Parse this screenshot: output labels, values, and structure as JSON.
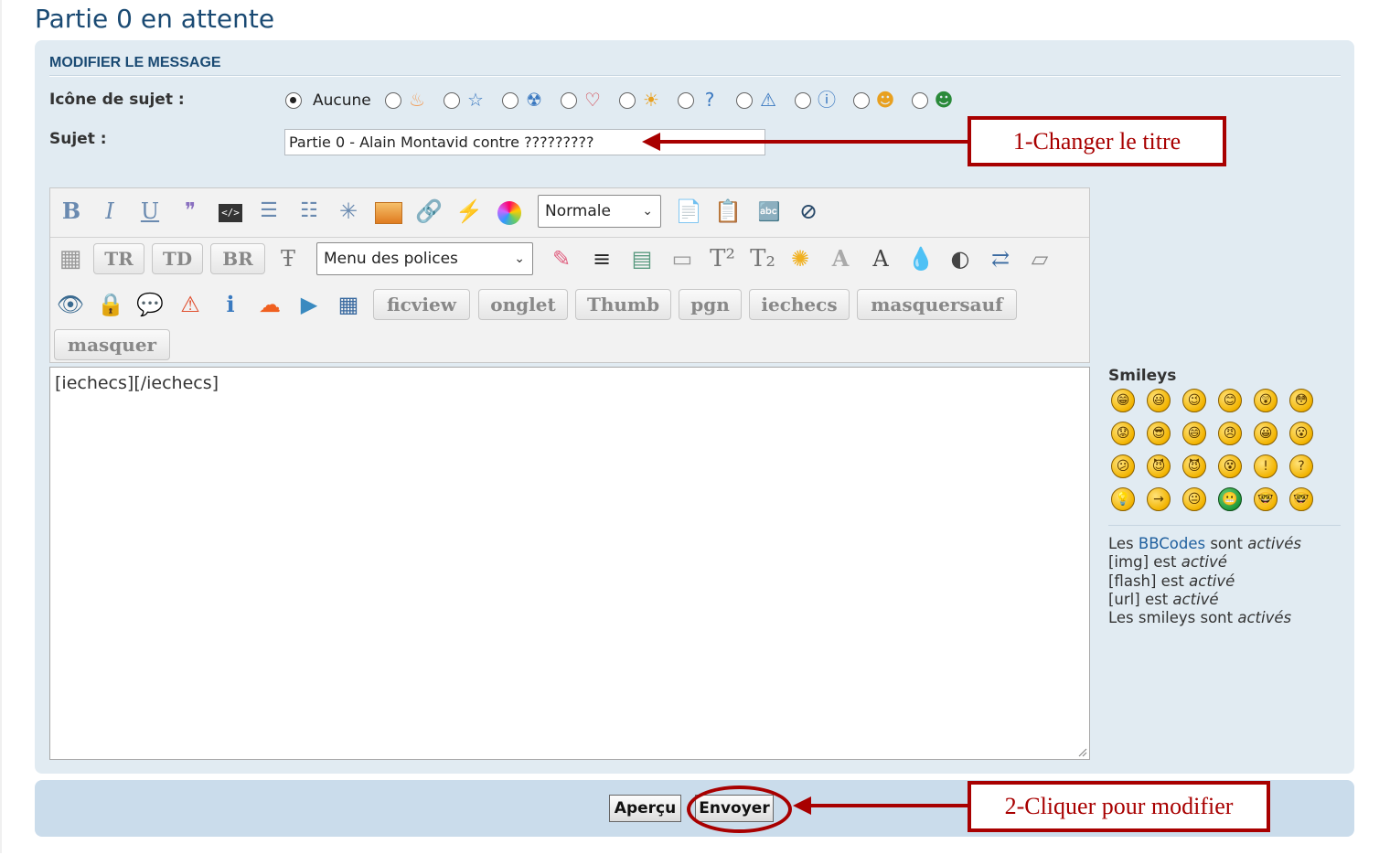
{
  "page": {
    "title": "Partie 0 en attente"
  },
  "form": {
    "section_title": "MODIFIER LE MESSAGE",
    "topic_icon_label": "Icône de sujet :",
    "topic_icon_none": "Aucune",
    "topic_icons": [
      "flame-icon",
      "star-icon",
      "radioactive-icon",
      "heart-icon",
      "sun-icon",
      "question-icon",
      "warning-icon",
      "info-icon",
      "wink-icon",
      "grin-icon"
    ],
    "subject_label": "Sujet :",
    "subject_value": "Partie 0  - Alain Montavid contre ?????????"
  },
  "toolbar": {
    "row1_icons": [
      "bold-icon",
      "italic-icon",
      "underline-icon",
      "quote-icon",
      "code-icon",
      "bullet-list-icon",
      "numbered-list-icon",
      "special-char-icon",
      "image-icon",
      "link-icon",
      "flash-icon",
      "color-icon"
    ],
    "size_select": "Normale",
    "row1_after": [
      "copy-icon",
      "paste-icon",
      "spellcheck-icon",
      "hide-icon"
    ],
    "table_buttons": [
      "TR",
      "TD",
      "BR"
    ],
    "font_select": "Menu des polices",
    "row2_icons": [
      "highlight-icon",
      "align-center-icon",
      "table-layout-icon",
      "frame-icon",
      "superscript-icon",
      "subscript-icon",
      "sun-glow-icon",
      "shadow-text-icon",
      "outline-text-icon",
      "drop-icon",
      "contrast-icon",
      "swap-icon",
      "page-icon"
    ],
    "row3_icons": [
      "spoiler-eye-icon",
      "lock-icon",
      "speech-icon",
      "alert-icon",
      "info-bar-icon",
      "soundcloud-icon",
      "video-icon",
      "grid-icon"
    ],
    "custom_buttons": [
      "ficview",
      "onglet",
      "Thumb",
      "pgn",
      "iechecs",
      "masquersauf",
      "masquer"
    ]
  },
  "editor": {
    "content": "[iechecs][/iechecs]"
  },
  "smileys": {
    "title": "Smileys",
    "items": [
      "😁",
      "😃",
      "😉",
      "😊",
      "😲",
      "😳",
      "😟",
      "😎",
      "😄",
      "😠",
      "😀",
      "😮",
      "😕",
      "😈",
      "😈",
      "😵",
      "!",
      "?",
      "💡",
      "→",
      "😐",
      "😬",
      "🤓",
      "🤓"
    ]
  },
  "options": {
    "line1_pre": "Les ",
    "line1_link": "BBCodes",
    "line1_mid": " sont ",
    "line1_em": "activés",
    "line2_pre": "[img] est ",
    "line2_em": "activé",
    "line3_pre": "[flash] est ",
    "line3_em": "activé",
    "line4_pre": "[url] est ",
    "line4_em": "activé",
    "line5_pre": "Les smileys sont ",
    "line5_em": "activés"
  },
  "actions": {
    "preview": "Aperçu",
    "submit": "Envoyer"
  },
  "annotations": {
    "callout1": "1-Changer le titre",
    "callout2": "2-Cliquer pour modifier",
    "color": "#a80000"
  }
}
